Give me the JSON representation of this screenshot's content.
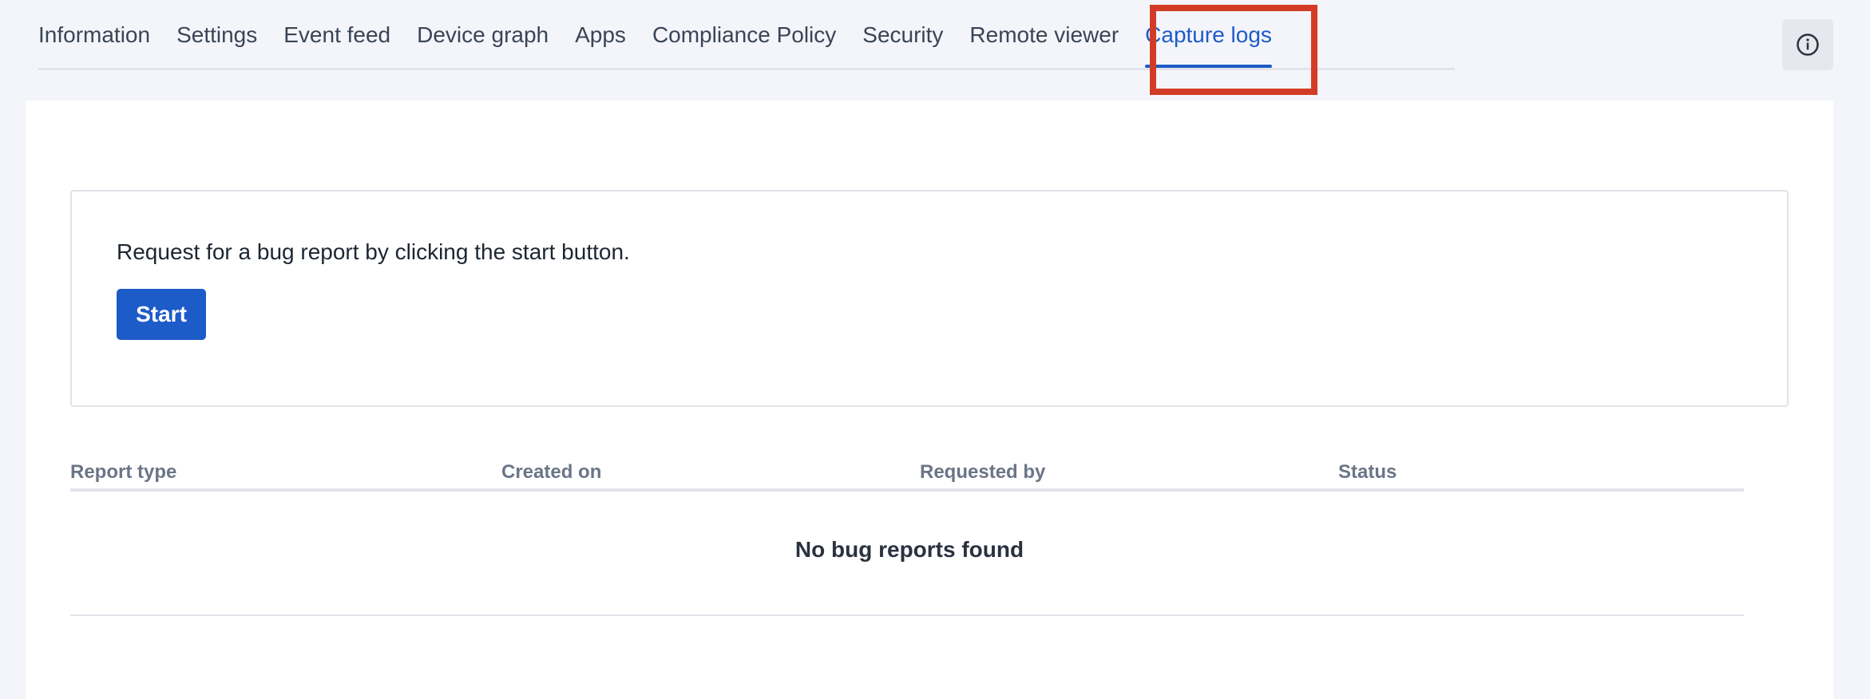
{
  "tabs": [
    {
      "label": "Information"
    },
    {
      "label": "Settings"
    },
    {
      "label": "Event feed"
    },
    {
      "label": "Device graph"
    },
    {
      "label": "Apps"
    },
    {
      "label": "Compliance Policy"
    },
    {
      "label": "Security"
    },
    {
      "label": "Remote viewer"
    },
    {
      "label": "Capture logs",
      "active": true
    }
  ],
  "info_icon": "info-circle-icon",
  "request": {
    "text": "Request for a bug report by clicking the start button.",
    "start_label": "Start"
  },
  "table": {
    "headers": [
      "Report type",
      "Created on",
      "Requested by",
      "Status"
    ],
    "empty_message": "No bug reports found"
  },
  "colors": {
    "accent": "#1d5bc9",
    "highlight": "#d23c26",
    "background": "#f4f5fa"
  }
}
